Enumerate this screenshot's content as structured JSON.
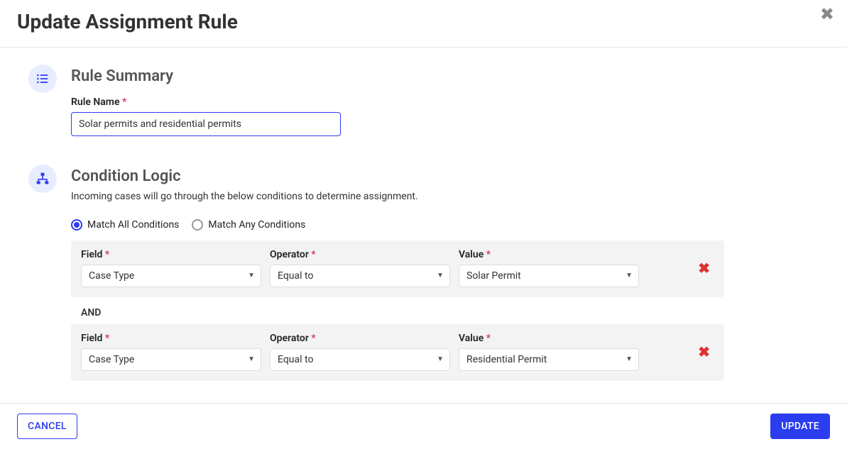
{
  "modal": {
    "title": "Update Assignment Rule"
  },
  "summary": {
    "heading": "Rule Summary",
    "name_label": "Rule Name",
    "name_value": "Solar permits and residential permits"
  },
  "logic": {
    "heading": "Condition Logic",
    "help": "Incoming cases will go through the below conditions to determine assignment.",
    "match_all_label": "Match All Conditions",
    "match_any_label": "Match Any Conditions",
    "selected_mode": "all",
    "joiner": "AND",
    "col_field_label": "Field",
    "col_operator_label": "Operator",
    "col_value_label": "Value",
    "rows": [
      {
        "field": "Case Type",
        "operator": "Equal to",
        "value": "Solar Permit"
      },
      {
        "field": "Case Type",
        "operator": "Equal to",
        "value": "Residential Permit"
      }
    ]
  },
  "footer": {
    "cancel": "CANCEL",
    "submit": "UPDATE"
  }
}
